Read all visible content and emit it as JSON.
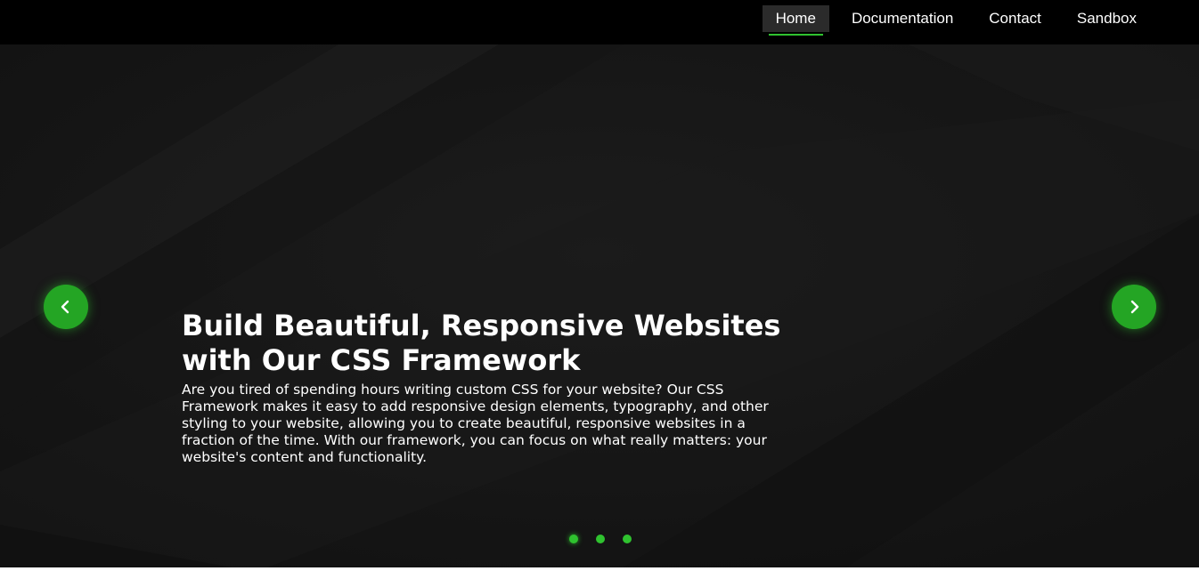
{
  "nav": {
    "items": [
      {
        "label": "Home",
        "active": true
      },
      {
        "label": "Documentation",
        "active": false
      },
      {
        "label": "Contact",
        "active": false
      },
      {
        "label": "Sandbox",
        "active": false
      }
    ]
  },
  "hero": {
    "title": "Build Beautiful, Responsive Websites with Our CSS Framework",
    "text": "Are you tired of spending hours writing custom CSS for your website? Our CSS Framework makes it easy to add responsive design elements, typography, and other styling to your website, allowing you to create beautiful, responsive websites in a fraction of the time. With our framework, you can focus on what really matters: your website's content and functionality.",
    "prev_icon": "chevron-left-icon",
    "next_icon": "chevron-right-icon"
  },
  "carousel": {
    "slide_count": 3,
    "active_index": 0
  },
  "colors": {
    "accent": "#2fc22f",
    "arrow_bg": "#24a524",
    "topbar_bg": "#000000",
    "hero_bg": "#171717",
    "active_nav_bg": "#2b2b2b"
  }
}
